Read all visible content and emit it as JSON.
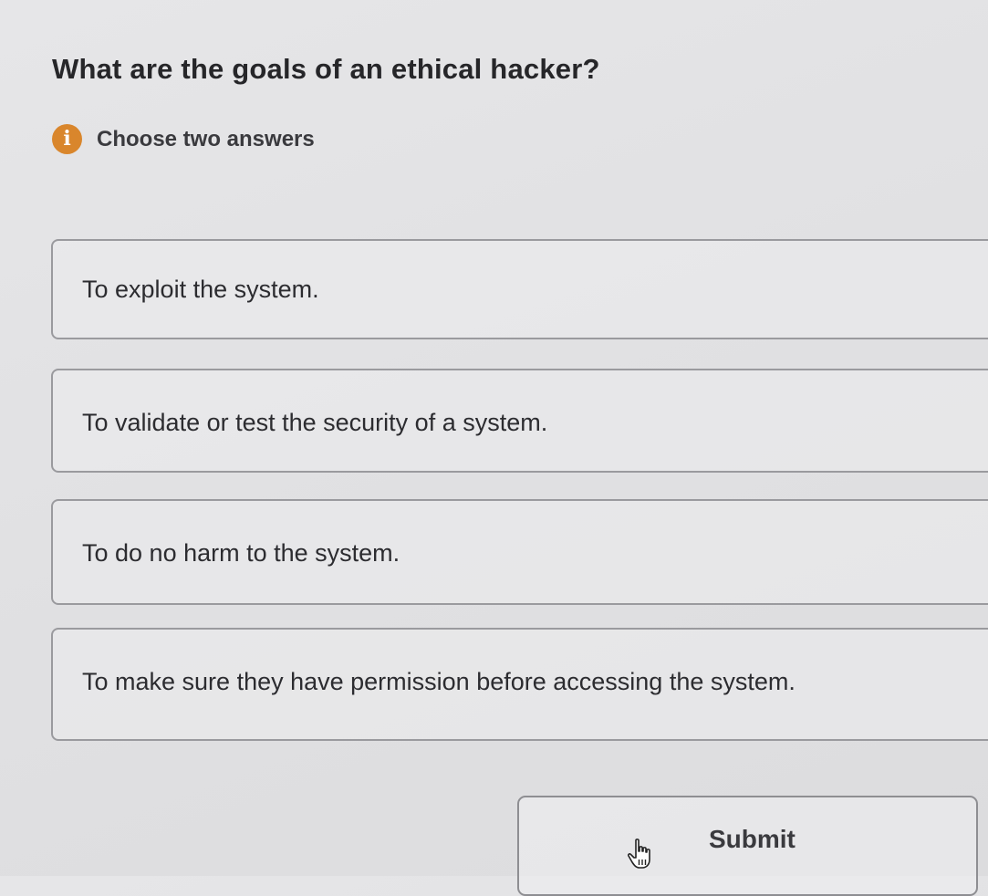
{
  "question": {
    "title": "What are the goals of an ethical hacker?",
    "hint_icon": "info-icon",
    "hint_text": "Choose two answers",
    "hint_icon_color": "#d9862c"
  },
  "options": [
    {
      "label": "To exploit the system."
    },
    {
      "label": "To validate or test the security of a system."
    },
    {
      "label": "To do no harm to the system."
    },
    {
      "label": "To make sure they have permission before accessing the system."
    }
  ],
  "submit": {
    "label": "Submit"
  },
  "cursor": {
    "icon": "hand-pointer-icon"
  }
}
